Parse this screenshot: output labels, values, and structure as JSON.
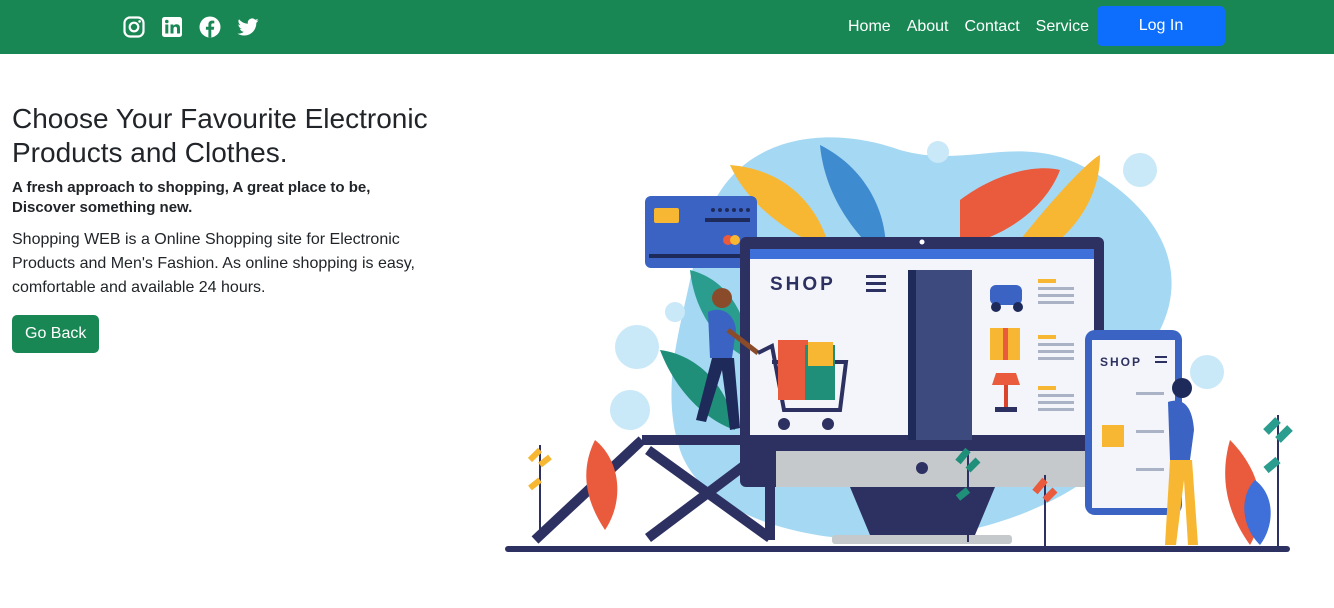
{
  "nav": {
    "social_icons": [
      "instagram-icon",
      "linkedin-icon",
      "facebook-icon",
      "twitter-icon"
    ],
    "links": [
      "Home",
      "About",
      "Contact",
      "Service"
    ],
    "login_label": "Log In"
  },
  "hero": {
    "title": "Choose Your Favourite Electronic Products and Clothes.",
    "subtitle": "A fresh approach to shopping, A great place to be, Discover something new.",
    "description": "Shopping WEB is a Online Shopping site for Electronic Products and Men's Fashion. As online shopping is easy, comfortable and available 24 hours.",
    "button_label": "Go Back"
  },
  "illustration": {
    "screen_brand": "SHOP",
    "phone_brand": "SHOP"
  },
  "colors": {
    "navbar": "#198754",
    "primary_button": "#0d6efd",
    "success_button": "#198754"
  }
}
